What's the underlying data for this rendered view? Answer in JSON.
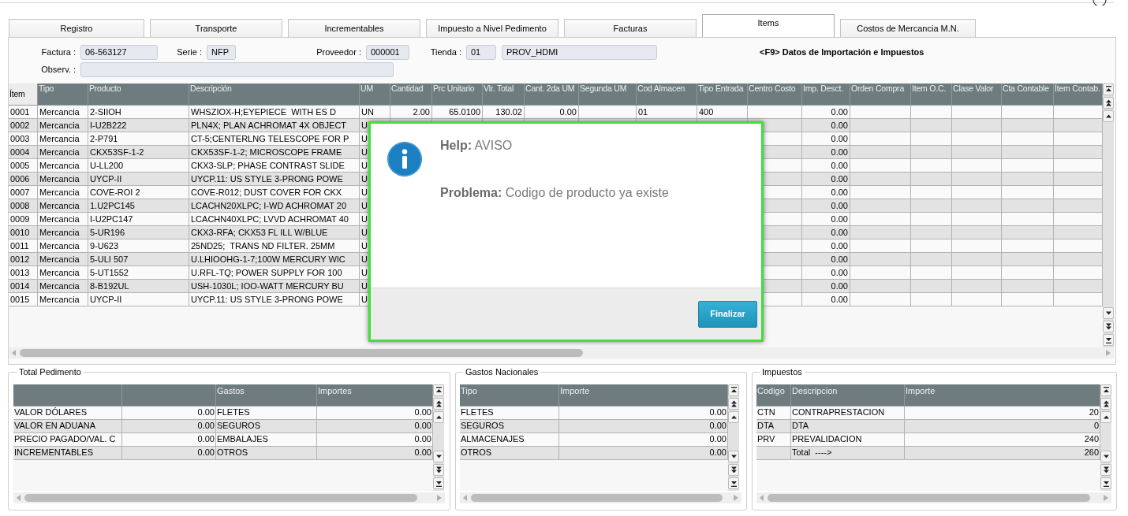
{
  "tabs": [
    {
      "label": "Registro",
      "selected": false
    },
    {
      "label": "Transporte",
      "selected": false
    },
    {
      "label": "Incrementables",
      "selected": false
    },
    {
      "label": "Impuesto a Nivel Pedimento",
      "selected": false
    },
    {
      "label": "Facturas",
      "selected": false
    },
    {
      "label": "Items",
      "selected": true
    },
    {
      "label": "Costos de Mercancia M.N.",
      "selected": false
    }
  ],
  "header_fields": [
    {
      "label": "Factura :",
      "value": "06-563127"
    },
    {
      "label": "Serie :",
      "value": "NFP"
    },
    {
      "label": "Proveedor :",
      "value": "000001"
    },
    {
      "label": "Tienda :",
      "value": "01"
    },
    {
      "value": "PROV_HDMI"
    }
  ],
  "observ": {
    "label": "Observ. :"
  },
  "section_title": "<F9> Datos de Importación e Impuestos",
  "items_table": {
    "columns": [
      "Ítem",
      "Tipo",
      "Producto",
      "Descripción",
      "UM",
      "Cantidad",
      "Prc Unitario",
      "Vlr. Total",
      "Cant. 2da UM",
      "Segunda UM",
      "Cod Almacen",
      "Tipo Entrada",
      "Centro Costo",
      "Imp. Desct.",
      "Orden Compra",
      "Item O.C.",
      "Clase Valor",
      "Cta Contable",
      "Ítem Contab."
    ],
    "rows": [
      {
        "cells": [
          "0001",
          "Mercancia",
          "2-SIIOH",
          "WHSZIOX-H;EYEPIECE  WITH ES D",
          "UN",
          "2.00",
          "65.0100",
          "130.02",
          "0.00",
          null,
          "01",
          "400",
          null,
          "0.00"
        ]
      },
      {
        "cells": [
          "0002",
          "Mercancia",
          "I-U2B222",
          "PLN4X; PLAN ACHROMAT 4X OBJECT",
          "U",
          null,
          null,
          null,
          null,
          null,
          null,
          null,
          null,
          "0.00"
        ]
      },
      {
        "cells": [
          "0003",
          "Mercancia",
          "2-P791",
          "CT-5;CENTERLNG TELESCOPE FOR P",
          "U",
          null,
          null,
          null,
          null,
          null,
          null,
          null,
          null,
          "0.00"
        ]
      },
      {
        "cells": [
          "0004",
          "Mercancia",
          "CKX53SF-1-2",
          "CKX53SF-1-2; MICROSCOPE FRAME",
          "U",
          null,
          null,
          null,
          null,
          null,
          null,
          null,
          null,
          "0.00"
        ]
      },
      {
        "cells": [
          "0005",
          "Mercancia",
          "U-LL200",
          "CKX3-SLP; PHASE CONTRAST SLIDE",
          "U",
          null,
          null,
          null,
          null,
          null,
          null,
          null,
          null,
          "0.00"
        ]
      },
      {
        "cells": [
          "0006",
          "Mercancia",
          "UYCP-II",
          "UYCP.11: US STYLE 3-PRONG POWE",
          "U",
          null,
          null,
          null,
          null,
          null,
          null,
          null,
          null,
          "0.00"
        ]
      },
      {
        "cells": [
          "0007",
          "Mercancia",
          "COVE-ROI 2",
          "COVE-R012; DUST COVER FOR CKX",
          "U",
          null,
          null,
          null,
          null,
          null,
          null,
          null,
          null,
          "0.00"
        ]
      },
      {
        "cells": [
          "0008",
          "Mercancia",
          "1.U2PC145",
          "LCACHN20XLPC; I-WD ACHROMAT 20",
          "U",
          null,
          null,
          null,
          null,
          null,
          null,
          null,
          null,
          "0.00"
        ]
      },
      {
        "cells": [
          "0009",
          "Mercancia",
          "I-U2PC147",
          "LCACHN40XLPC; LVVD ACHROMAT 40",
          "U",
          null,
          null,
          null,
          null,
          null,
          null,
          null,
          null,
          "0.00"
        ]
      },
      {
        "cells": [
          "0010",
          "Mercancia",
          "5-UR196",
          "CKX3-RFA; CKX53 FL ILL W/BLUE",
          "U",
          null,
          null,
          null,
          null,
          null,
          null,
          null,
          null,
          "0.00"
        ]
      },
      {
        "cells": [
          "0011",
          "Mercancia",
          "9-U623",
          "25ND25;  TRANS ND FILTER. 25MM",
          "U",
          null,
          null,
          null,
          null,
          null,
          null,
          null,
          null,
          "0.00"
        ]
      },
      {
        "cells": [
          "0012",
          "Mercancia",
          "5-ULI 507",
          "U.LHIOOHG-1-7;100W MERCURY WIC",
          "U",
          null,
          null,
          null,
          null,
          null,
          null,
          null,
          null,
          "0.00"
        ]
      },
      {
        "cells": [
          "0013",
          "Mercancia",
          "5-UT1552",
          "U.RFL-TQ; POWER SUPPLY FOR 100",
          "U",
          null,
          null,
          null,
          null,
          null,
          null,
          null,
          null,
          "0.00"
        ]
      },
      {
        "cells": [
          "0014",
          "Mercancia",
          "8-B192UL",
          "USH-1030L; IOO-WATT MERCURY BU",
          "U",
          null,
          null,
          null,
          null,
          null,
          null,
          null,
          null,
          "0.00"
        ]
      },
      {
        "cells": [
          "0015",
          "Mercancia",
          "UYCP-II",
          "UYCP.11: US STYLE 3-PRONG POWE",
          "U",
          null,
          null,
          null,
          null,
          null,
          null,
          null,
          null,
          "0.00"
        ]
      }
    ]
  },
  "dialog": {
    "help": "**Help:** AVISO",
    "problem": "**Problema:** Codigo de producto ya existe",
    "button": "Finalizar"
  },
  "total_pedimento": {
    "title": "Total Pedimento",
    "columns": [
      null,
      null,
      "Gastos",
      "Importes"
    ],
    "rows": [
      [
        "VALOR DÓLARES",
        "0.00",
        "FLETES",
        "0.00"
      ],
      [
        "VALOR EN ADUANA",
        "0.00",
        "SEGUROS",
        "0.00"
      ],
      [
        "PRECIO PAGADO/VAL. C",
        "0.00",
        "EMBALAJES",
        "0.00"
      ],
      [
        "INCREMENTABLES",
        "0.00",
        "OTROS",
        "0.00"
      ]
    ]
  },
  "gastos_nacionales": {
    "title": "Gastos Nacionales",
    "columns": [
      "Tipo",
      "Importe"
    ],
    "rows": [
      [
        "FLETES",
        "0.00"
      ],
      [
        "SEGUROS",
        "0.00"
      ],
      [
        "ALMACENAJES",
        "0.00"
      ],
      [
        "OTROS",
        "0.00"
      ]
    ]
  },
  "impuestos": {
    "title": "Impuestos",
    "columns": [
      "Codigo",
      "Descripcion",
      "Importe"
    ],
    "rows": [
      [
        "CTN",
        "CONTRAPRESTACION",
        "20"
      ],
      [
        "DTA",
        "DTA",
        "0"
      ],
      [
        "PRV",
        "PREVALIDACION",
        "240"
      ],
      [
        null,
        "Total  ---->",
        "260"
      ]
    ]
  }
}
